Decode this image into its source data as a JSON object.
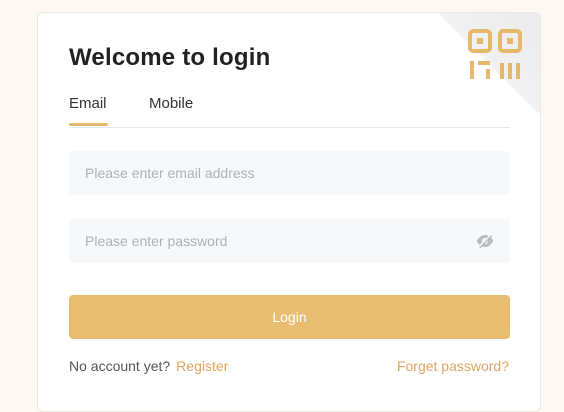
{
  "login": {
    "title": "Welcome to login",
    "tabs": [
      {
        "label": "Email",
        "active": true
      },
      {
        "label": "Mobile",
        "active": false
      }
    ],
    "email_placeholder": "Please enter email address",
    "password_placeholder": "Please enter password",
    "login_label": "Login",
    "no_account_text": "No account yet?",
    "register_label": "Register",
    "forget_label": "Forget password?"
  },
  "icons": {
    "qr": "qr-code-icon",
    "eye": "eye-hidden-icon"
  },
  "colors": {
    "accent": "#e9bd71",
    "link": "#e0a55b",
    "tab_underline": "#e6b86a",
    "background": "#fdf8f1"
  }
}
